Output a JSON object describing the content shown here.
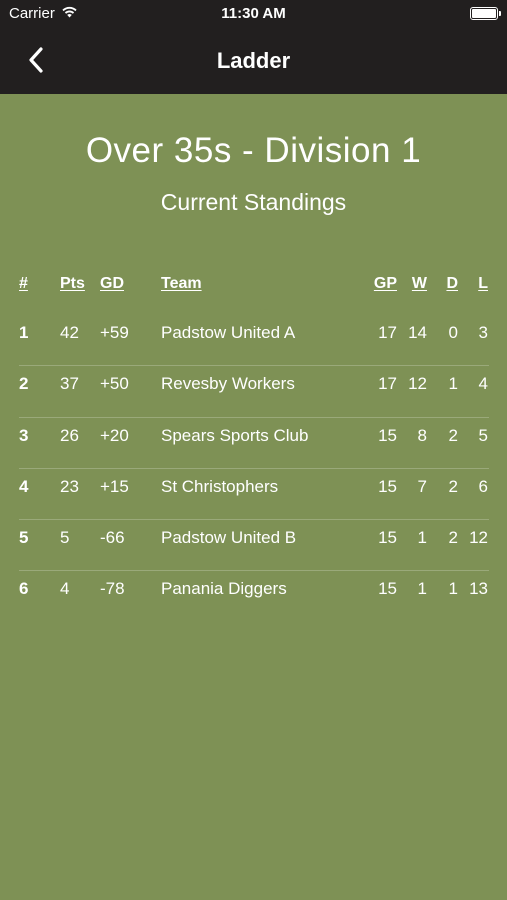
{
  "status_bar": {
    "carrier": "Carrier",
    "time": "11:30 AM",
    "icons": [
      "wifi-icon",
      "battery-icon"
    ]
  },
  "nav": {
    "title": "Ladder",
    "back_icon": "chevron-left-icon"
  },
  "heading": {
    "title": "Over 35s - Division 1",
    "subtitle": "Current Standings"
  },
  "table": {
    "columns": {
      "rank": "#",
      "pts": "Pts",
      "gd": "GD",
      "team": "Team",
      "gp": "GP",
      "w": "W",
      "d": "D",
      "l": "L"
    },
    "rows": [
      {
        "rank": "1",
        "pts": "42",
        "gd": "+59",
        "team": "Padstow United A",
        "gp": "17",
        "w": "14",
        "d": "0",
        "l": "3"
      },
      {
        "rank": "2",
        "pts": "37",
        "gd": "+50",
        "team": "Revesby Workers",
        "gp": "17",
        "w": "12",
        "d": "1",
        "l": "4"
      },
      {
        "rank": "3",
        "pts": "26",
        "gd": "+20",
        "team": "Spears Sports Club",
        "gp": "15",
        "w": "8",
        "d": "2",
        "l": "5"
      },
      {
        "rank": "4",
        "pts": "23",
        "gd": "+15",
        "team": "St Christophers",
        "gp": "15",
        "w": "7",
        "d": "2",
        "l": "6"
      },
      {
        "rank": "5",
        "pts": "5",
        "gd": "-66",
        "team": "Padstow United B",
        "gp": "15",
        "w": "1",
        "d": "2",
        "l": "12"
      },
      {
        "rank": "6",
        "pts": "4",
        "gd": "-78",
        "team": "Panania Diggers",
        "gp": "15",
        "w": "1",
        "d": "1",
        "l": "13"
      }
    ]
  },
  "colors": {
    "background": "#7e9155",
    "topbar": "#221f1f",
    "text": "#ffffff"
  }
}
